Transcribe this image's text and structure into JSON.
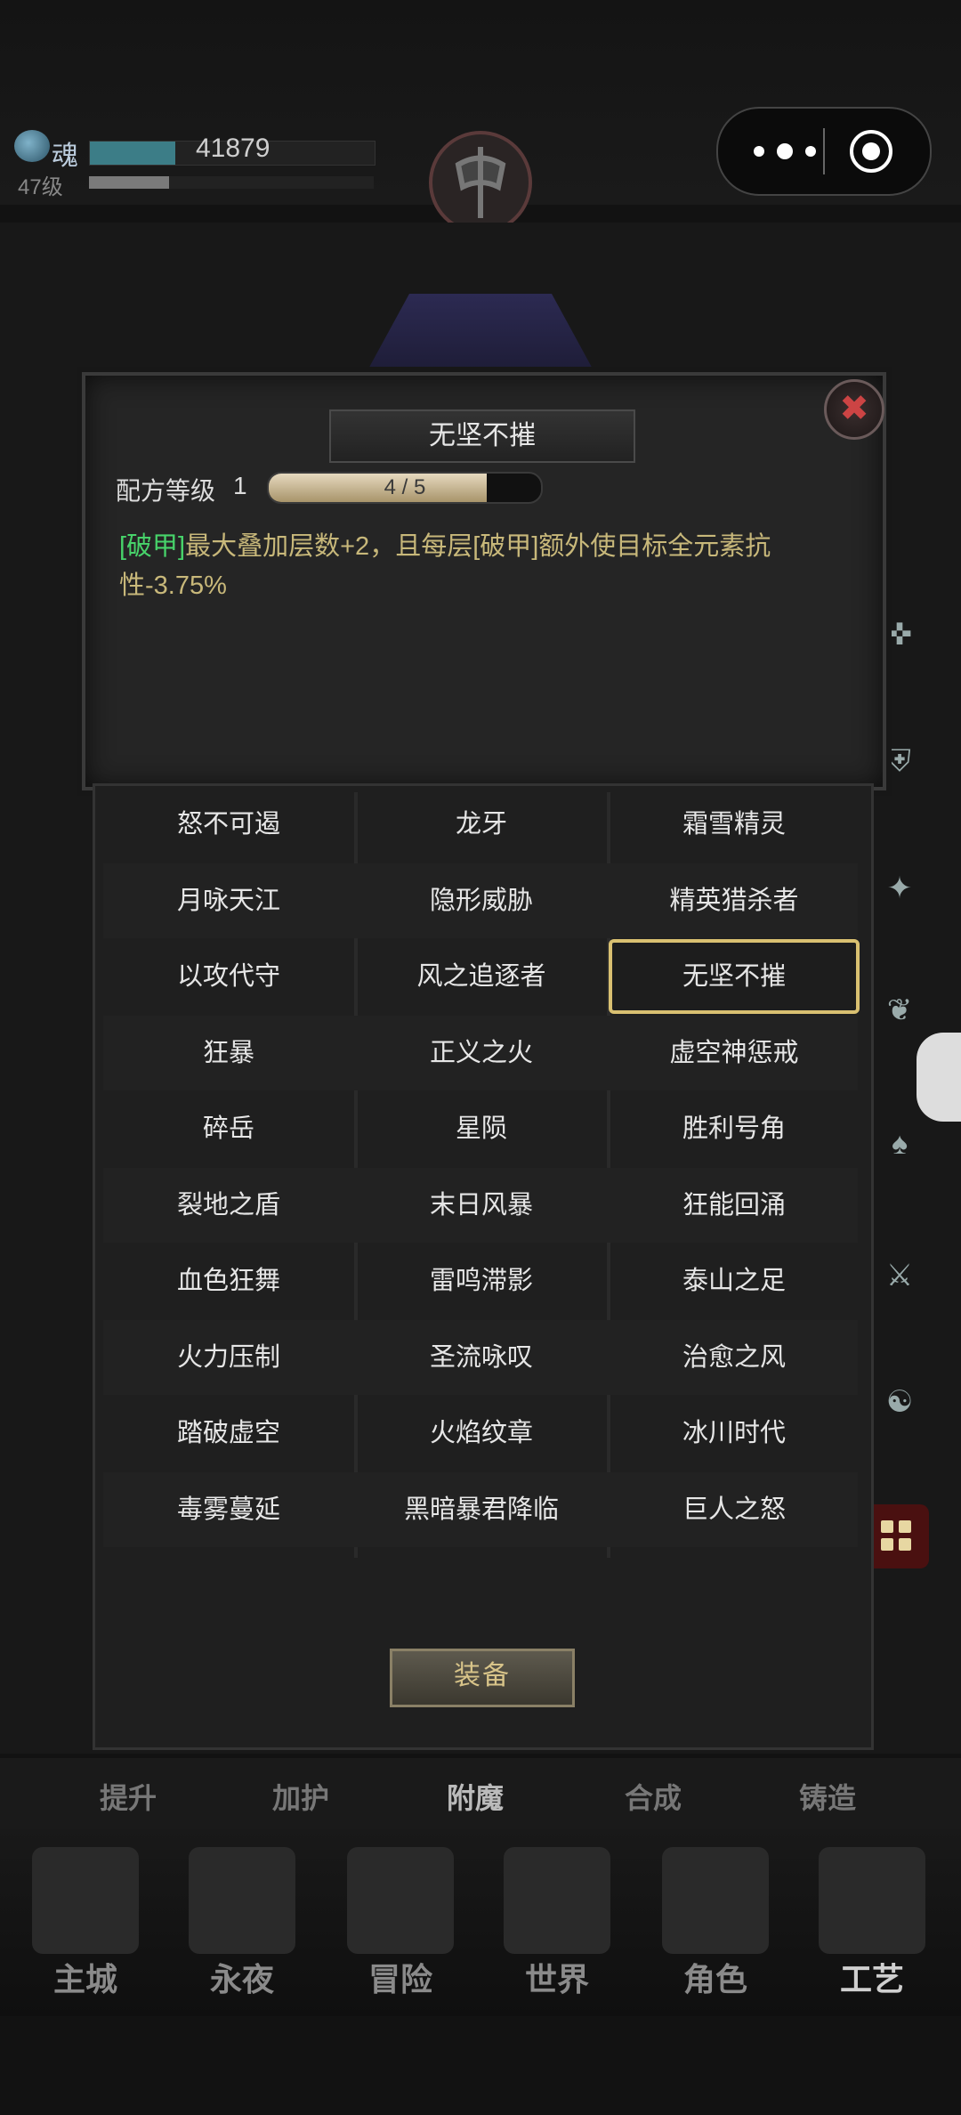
{
  "header": {
    "soul_label": "魂",
    "soul_value": "41879",
    "soul_fill": 0.3,
    "level": "47级",
    "exp_fill": 0.28
  },
  "dialog": {
    "title": "无坚不摧",
    "recipe_level_label": "配方等级",
    "recipe_level": "1",
    "progress_text": "4 / 5",
    "progress_fraction": 0.8,
    "desc_tag": "[破甲]",
    "desc_rest": "最大叠加层数+2，且每层[破甲]额外使目标全元素抗性-3.75%"
  },
  "recipes": [
    [
      "怒不可遏",
      "龙牙",
      "霜雪精灵"
    ],
    [
      "月咏天江",
      "隐形威胁",
      "精英猎杀者"
    ],
    [
      "以攻代守",
      "风之追逐者",
      "无坚不摧"
    ],
    [
      "狂暴",
      "正义之火",
      "虚空神惩戒"
    ],
    [
      "碎岳",
      "星陨",
      "胜利号角"
    ],
    [
      "裂地之盾",
      "末日风暴",
      "狂能回涌"
    ],
    [
      "血色狂舞",
      "雷鸣滞影",
      "泰山之足"
    ],
    [
      "火力压制",
      "圣流咏叹",
      "治愈之风"
    ],
    [
      "踏破虚空",
      "火焰纹章",
      "冰川时代"
    ],
    [
      "毒雾蔓延",
      "黑暗暴君降临",
      "巨人之怒"
    ]
  ],
  "equip_label": "装备",
  "sub_tabs": [
    "提升",
    "加护",
    "附魔",
    "合成",
    "铸造"
  ],
  "nav": [
    "主城",
    "永夜",
    "冒险",
    "世界",
    "角色",
    "工艺"
  ]
}
